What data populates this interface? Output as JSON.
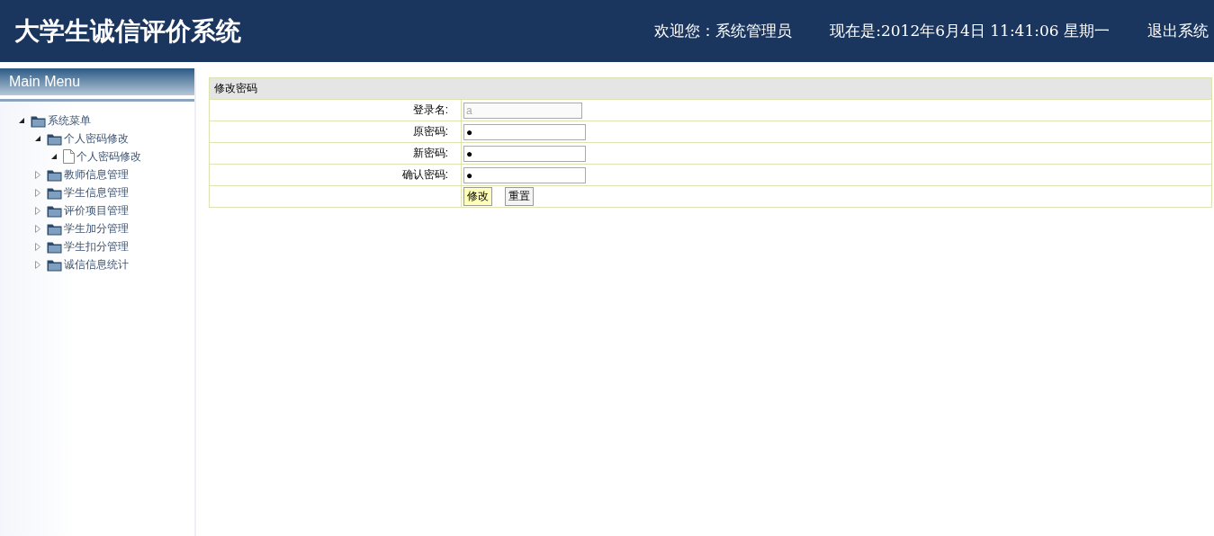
{
  "header": {
    "title": "大学生诚信评价系统",
    "welcome": "欢迎您：系统管理员",
    "time": "现在是:2012年6月4日  11:41:06 星期一",
    "logout": "退出系统"
  },
  "sidebar": {
    "title": "Main Menu",
    "tree": [
      {
        "label": "系统菜单",
        "kind": "folder",
        "expanded": true,
        "children": [
          {
            "label": "个人密码修改",
            "kind": "folder",
            "expanded": true,
            "children": [
              {
                "label": "个人密码修改",
                "kind": "file",
                "expanded": true
              }
            ]
          },
          {
            "label": "教师信息管理",
            "kind": "folder",
            "expanded": false
          },
          {
            "label": "学生信息管理",
            "kind": "folder",
            "expanded": false
          },
          {
            "label": "评价项目管理",
            "kind": "folder",
            "expanded": false
          },
          {
            "label": "学生加分管理",
            "kind": "folder",
            "expanded": false
          },
          {
            "label": "学生扣分管理",
            "kind": "folder",
            "expanded": false
          },
          {
            "label": "诚信信息统计",
            "kind": "folder",
            "expanded": false
          }
        ]
      }
    ]
  },
  "form": {
    "title": "修改密码",
    "fields": [
      {
        "label": "登录名:",
        "value": "a",
        "disabled": true
      },
      {
        "label": "原密码:",
        "value": "●",
        "disabled": false
      },
      {
        "label": "新密码:",
        "value": "●",
        "disabled": false
      },
      {
        "label": "确认密码:",
        "value": "●",
        "disabled": false
      }
    ],
    "buttons": [
      {
        "label": "修改",
        "selected": true
      },
      {
        "label": "重置",
        "selected": false
      }
    ]
  }
}
